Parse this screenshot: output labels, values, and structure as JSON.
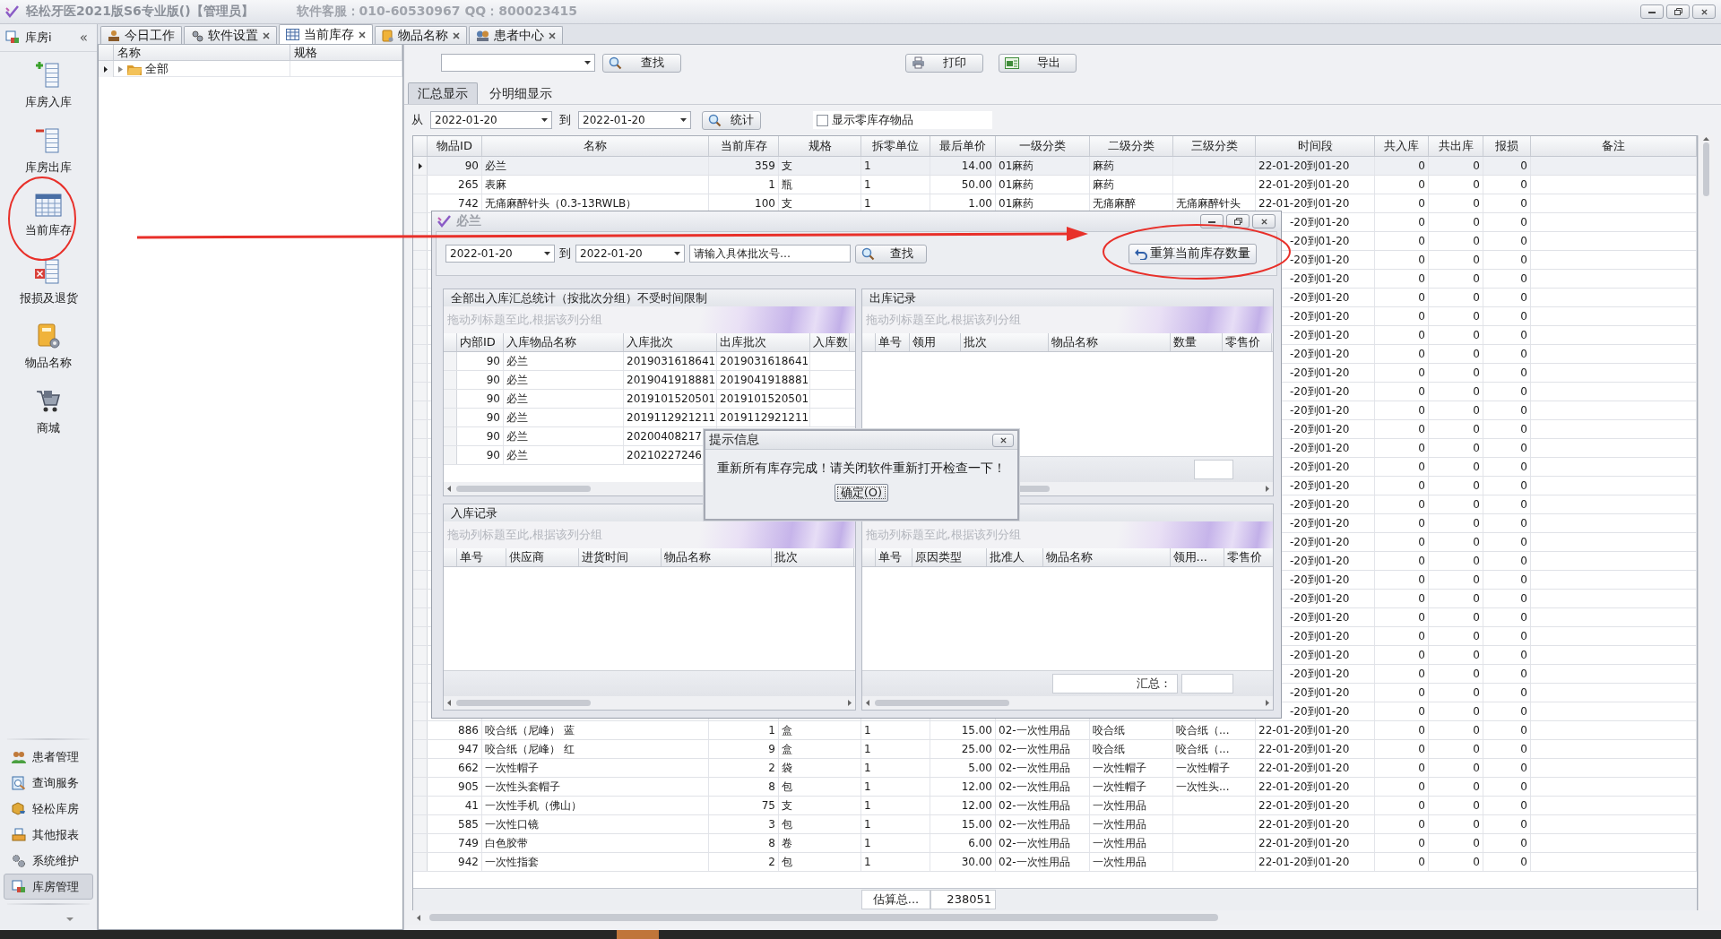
{
  "window": {
    "title": "轻松牙医2021版S6专业版()【管理员】",
    "support": "软件客服：010-60530967 QQ：800023415"
  },
  "sidebar": {
    "title": "库房i",
    "collapse": "«",
    "items": [
      {
        "label": "库房入库"
      },
      {
        "label": "库房出库"
      },
      {
        "label": "当前库存"
      },
      {
        "label": "报损及退货"
      },
      {
        "label": "物品名称"
      },
      {
        "label": "商城"
      }
    ],
    "nav": [
      {
        "label": "患者管理",
        "selected": false
      },
      {
        "label": "查询服务",
        "selected": false
      },
      {
        "label": "轻松库房",
        "selected": false
      },
      {
        "label": "其他报表",
        "selected": false
      },
      {
        "label": "系统维护",
        "selected": false
      },
      {
        "label": "库房管理",
        "selected": true
      }
    ]
  },
  "tabs": [
    {
      "label": "今日工作",
      "selected": false,
      "closable": false
    },
    {
      "label": "软件设置",
      "selected": false,
      "closable": true
    },
    {
      "label": "当前库存",
      "selected": true,
      "closable": true
    },
    {
      "label": "物品名称",
      "selected": false,
      "closable": true
    },
    {
      "label": "患者中心",
      "selected": false,
      "closable": true
    }
  ],
  "tree": {
    "columns": [
      "名称",
      "规格"
    ],
    "rows": [
      {
        "label": "全部",
        "selected": true,
        "expanded": false
      }
    ]
  },
  "toolbar": {
    "search_button": "查找",
    "print_button": "打印",
    "export_button": "导出"
  },
  "view_tabs": [
    {
      "label": "汇总显示",
      "selected": true
    },
    {
      "label": "分明细显示",
      "selected": false
    }
  ],
  "filter": {
    "from_label": "从",
    "from": "2022-01-20",
    "to_label": "到",
    "to": "2022-01-20",
    "stat_button": "统计",
    "zero_stock": {
      "label": "显示零库存物品",
      "checked": false
    }
  },
  "table": {
    "columns": [
      "物品ID",
      "名称",
      "当前库存",
      "规格",
      "拆零单位",
      "最后单价",
      "一级分类",
      "二级分类",
      "三级分类",
      "时间段",
      "共入库",
      "共出库",
      "报损",
      "备注"
    ],
    "rows": [
      {
        "kind": "full",
        "selected": true,
        "cells": [
          "90",
          "必兰",
          "359",
          "支",
          "1",
          "14.00",
          "01麻药",
          "麻药",
          "",
          "22-01-20到01-20",
          "0",
          "0",
          "0"
        ]
      },
      {
        "kind": "full",
        "selected": false,
        "cells": [
          "265",
          "表麻",
          "1",
          "瓶",
          "1",
          "50.00",
          "01麻药",
          "麻药",
          "",
          "22-01-20到01-20",
          "0",
          "0",
          "0"
        ]
      },
      {
        "kind": "full",
        "selected": false,
        "cells": [
          "742",
          "无痛麻醉针头（0.3-13RWLB）",
          "100",
          "支",
          "1",
          "1.00",
          "01麻药",
          "无痛麻醉",
          "无痛麻醉针头",
          "22-01-20到01-20",
          "0",
          "0",
          "0"
        ]
      },
      {
        "kind": "covered",
        "selected": false,
        "cells": [
          "-20到01-20",
          "0",
          "0",
          "0"
        ]
      },
      {
        "kind": "covered",
        "selected": false,
        "cells": [
          "-20到01-20",
          "0",
          "0",
          "0"
        ]
      },
      {
        "kind": "covered",
        "selected": false,
        "cells": [
          "-20到01-20",
          "0",
          "0",
          "0"
        ]
      },
      {
        "kind": "covered",
        "selected": false,
        "cells": [
          "-20到01-20",
          "0",
          "0",
          "0"
        ]
      },
      {
        "kind": "covered",
        "selected": false,
        "cells": [
          "-20到01-20",
          "0",
          "0",
          "0"
        ]
      },
      {
        "kind": "covered",
        "selected": false,
        "cells": [
          "-20到01-20",
          "0",
          "0",
          "0"
        ]
      },
      {
        "kind": "covered",
        "selected": false,
        "cells": [
          "-20到01-20",
          "0",
          "0",
          "0"
        ]
      },
      {
        "kind": "covered",
        "selected": false,
        "cells": [
          "-20到01-20",
          "0",
          "0",
          "0"
        ]
      },
      {
        "kind": "covered",
        "selected": false,
        "cells": [
          "-20到01-20",
          "0",
          "0",
          "0"
        ]
      },
      {
        "kind": "covered",
        "selected": false,
        "cells": [
          "-20到01-20",
          "0",
          "0",
          "0"
        ]
      },
      {
        "kind": "covered",
        "selected": false,
        "cells": [
          "-20到01-20",
          "0",
          "0",
          "0"
        ]
      },
      {
        "kind": "covered",
        "selected": false,
        "cells": [
          "-20到01-20",
          "0",
          "0",
          "0"
        ]
      },
      {
        "kind": "covered",
        "selected": false,
        "cells": [
          "-20到01-20",
          "0",
          "0",
          "0"
        ]
      },
      {
        "kind": "covered",
        "selected": false,
        "cells": [
          "-20到01-20",
          "0",
          "0",
          "0"
        ]
      },
      {
        "kind": "covered",
        "selected": false,
        "cells": [
          "-20到01-20",
          "0",
          "0",
          "0"
        ]
      },
      {
        "kind": "covered",
        "selected": false,
        "cells": [
          "-20到01-20",
          "0",
          "0",
          "0"
        ]
      },
      {
        "kind": "covered",
        "selected": false,
        "cells": [
          "-20到01-20",
          "0",
          "0",
          "0"
        ]
      },
      {
        "kind": "covered",
        "selected": false,
        "cells": [
          "-20到01-20",
          "0",
          "0",
          "0"
        ]
      },
      {
        "kind": "covered",
        "selected": false,
        "cells": [
          "-20到01-20",
          "0",
          "0",
          "0"
        ]
      },
      {
        "kind": "covered",
        "selected": false,
        "cells": [
          "-20到01-20",
          "0",
          "0",
          "0"
        ]
      },
      {
        "kind": "covered",
        "selected": false,
        "cells": [
          "-20到01-20",
          "0",
          "0",
          "0"
        ]
      },
      {
        "kind": "covered",
        "selected": false,
        "cells": [
          "-20到01-20",
          "0",
          "0",
          "0"
        ]
      },
      {
        "kind": "covered",
        "selected": false,
        "cells": [
          "-20到01-20",
          "0",
          "0",
          "0"
        ]
      },
      {
        "kind": "covered",
        "selected": false,
        "cells": [
          "-20到01-20",
          "0",
          "0",
          "0"
        ]
      },
      {
        "kind": "covered",
        "selected": false,
        "cells": [
          "-20到01-20",
          "0",
          "0",
          "0"
        ]
      },
      {
        "kind": "covered",
        "selected": false,
        "cells": [
          "-20到01-20",
          "0",
          "0",
          "0"
        ]
      },
      {
        "kind": "covered",
        "selected": false,
        "cells": [
          "-20到01-20",
          "0",
          "0",
          "0"
        ]
      },
      {
        "kind": "full",
        "selected": false,
        "cells": [
          "886",
          "咬合纸（尼峰） 蓝",
          "1",
          "盒",
          "1",
          "15.00",
          "02-一次性用品",
          "咬合纸",
          "咬合纸（...",
          "22-01-20到01-20",
          "0",
          "0",
          "0"
        ]
      },
      {
        "kind": "full",
        "selected": false,
        "cells": [
          "947",
          "咬合纸（尼峰） 红",
          "9",
          "盒",
          "1",
          "25.00",
          "02-一次性用品",
          "咬合纸",
          "咬合纸（...",
          "22-01-20到01-20",
          "0",
          "0",
          "0"
        ]
      },
      {
        "kind": "full",
        "selected": false,
        "cells": [
          "662",
          "一次性帽子",
          "2",
          "袋",
          "1",
          "5.00",
          "02-一次性用品",
          "一次性帽子",
          "一次性帽子",
          "22-01-20到01-20",
          "0",
          "0",
          "0"
        ]
      },
      {
        "kind": "full",
        "selected": false,
        "cells": [
          "905",
          "一次性头套帽子",
          "8",
          "包",
          "1",
          "12.00",
          "02-一次性用品",
          "一次性帽子",
          "一次性头...",
          "22-01-20到01-20",
          "0",
          "0",
          "0"
        ]
      },
      {
        "kind": "full",
        "selected": false,
        "cells": [
          "41",
          "一次性手机（佛山）",
          "75",
          "支",
          "1",
          "12.00",
          "02-一次性用品",
          "一次性用品",
          "",
          "22-01-20到01-20",
          "0",
          "0",
          "0"
        ]
      },
      {
        "kind": "full",
        "selected": false,
        "cells": [
          "585",
          "一次性口镜",
          "3",
          "包",
          "1",
          "15.00",
          "02-一次性用品",
          "一次性用品",
          "",
          "22-01-20到01-20",
          "0",
          "0",
          "0"
        ]
      },
      {
        "kind": "full",
        "selected": false,
        "cells": [
          "749",
          "白色胶带",
          "8",
          "卷",
          "1",
          "6.00",
          "02-一次性用品",
          "一次性用品",
          "",
          "22-01-20到01-20",
          "0",
          "0",
          "0"
        ]
      },
      {
        "kind": "full",
        "selected": false,
        "cells": [
          "942",
          "一次性指套",
          "2",
          "包",
          "1",
          "30.00",
          "02-一次性用品",
          "一次性用品",
          "",
          "22-01-20到01-20",
          "0",
          "0",
          "0"
        ]
      }
    ],
    "summary": {
      "label": "估算总...",
      "value": "238051"
    }
  },
  "detail_dialog": {
    "title": "必兰",
    "from": "2022-01-20",
    "to_label": "到",
    "to": "2022-01-20",
    "batch_field": {
      "placeholder": "请输入具体批次号…"
    },
    "search_button": "查找",
    "recalc_button": "重算当前库存数量",
    "panels": [
      {
        "kind": "summary",
        "title": "全部出入库汇总统计（按批次分组）不受时间限制",
        "group_hint": "拖动列标题至此,根据该列分组",
        "columns": [
          "内部ID",
          "入库物品名称",
          "入库批次",
          "出库批次",
          "入库数"
        ],
        "rows": [
          {
            "cells": [
              "90",
              "必兰",
              "2019031618641",
              "2019031618641"
            ]
          },
          {
            "cells": [
              "90",
              "必兰",
              "2019041918881",
              "2019041918881"
            ]
          },
          {
            "cells": [
              "90",
              "必兰",
              "2019101520501",
              "2019101520501"
            ]
          },
          {
            "cells": [
              "90",
              "必兰",
              "2019112921211",
              "2019112921211"
            ]
          },
          {
            "cells": [
              "90",
              "必兰",
              "20200408217"
            ]
          },
          {
            "cells": [
              "90",
              "必兰",
              "20210227246"
            ]
          }
        ]
      },
      {
        "kind": "box",
        "title": "出库记录",
        "group_hint": "拖动列标题至此,根据该列分组",
        "columns": [
          "单号",
          "领用",
          "批次",
          "物品名称",
          "数量",
          "零售价"
        ]
      },
      {
        "kind": "bar",
        "title": "入库记录",
        "group_hint": "拖动列标题至此,根据该列分组",
        "columns": [
          "单号",
          "供应商",
          "进货时间",
          "物品名称",
          "批次"
        ]
      },
      {
        "kind": "total",
        "group_hint": "拖动列标题至此,根据该列分组",
        "columns": [
          "单号",
          "原因类型",
          "批准人",
          "物品名称",
          "领用...",
          "零售价"
        ],
        "total_label": "汇总："
      }
    ]
  },
  "message_box": {
    "title": "提示信息",
    "message": "重新所有库存完成！请关闭软件重新打开检查一下！",
    "ok_button": "确定(O)"
  }
}
